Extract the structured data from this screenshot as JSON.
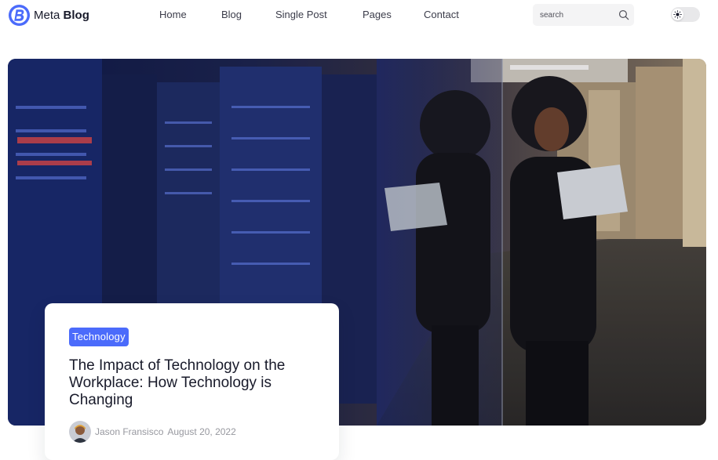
{
  "header": {
    "logo_word1": "Meta",
    "logo_word2": "Blog",
    "nav": [
      "Home",
      "Blog",
      "Single Post",
      "Pages",
      "Contact"
    ],
    "search_placeholder": "search"
  },
  "hero": {
    "image": "woman-holding-laptop-in-server-room-corridor"
  },
  "featured_post": {
    "category": "Technology",
    "title": "The Impact of Technology on the Workplace: How Technology is Changing",
    "author": "Jason Fransisco",
    "date": "August 20, 2022"
  },
  "colors": {
    "accent": "#4B6BFB",
    "heading": "#181A2A",
    "muted": "#97989F"
  }
}
